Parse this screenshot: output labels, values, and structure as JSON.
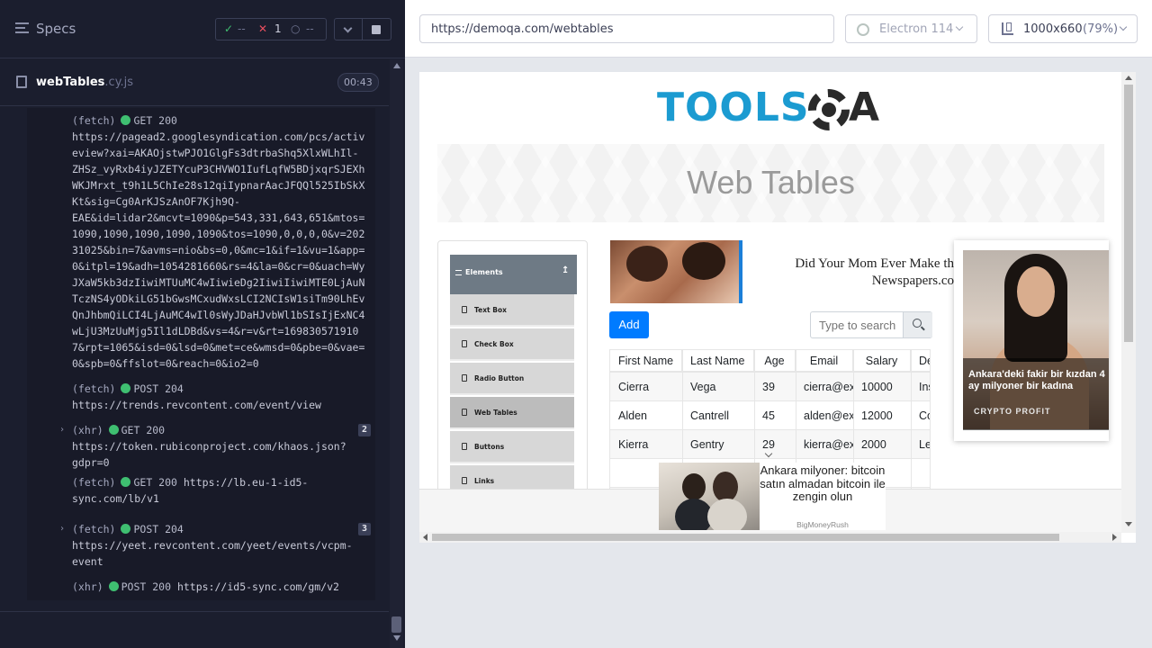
{
  "runner": {
    "specs_label": "Specs",
    "stats": {
      "passed": "--",
      "failed": "1",
      "pending": "--"
    },
    "spec_file": {
      "name": "webTables",
      "ext": ".cy.js",
      "duration": "00:43"
    },
    "log": [
      {
        "type": "(fetch)",
        "method": "GET 200",
        "lines": [
          "https://pagead2.googlesyndication.com/pcs/activ",
          "eview?xai=AKAOjstwPJO1GlgFs3dtrbaShq5XlxWLhIl-",
          "ZHSz_vyRxb4iyJZETYcuP3CHVWO1IufLqfW5BDjxqrSJEXh",
          "WKJMrxt_t9h1L5ChIe28s12qiIypnarAacJFQQl525IbSkX",
          "Kt&sig=Cg0ArKJSzAnOF7Kjh9Q-",
          "EAE&id=lidar2&mcvt=1090&p=543,331,643,651&mtos=",
          "1090,1090,1090,1090,1090&tos=1090,0,0,0,0&v=202",
          "31025&bin=7&avms=nio&bs=0,0&mc=1&if=1&vu=1&app=",
          "0&itpl=19&adh=1054281660&rs=4&la=0&cr=0&uach=Wy",
          "JXaW5kb3dzIiwiMTUuMC4wIiwieDg2IiwiIiwiMTE0LjAuN",
          "TczNS4yODkiLG51bGwsMCxudWxsLCI2NCIsW1siTm90LhEv",
          "QnJhbmQiLCI4LjAuMC4wIl0sWyJDaHJvbWl1bSIsIjExNC4",
          "wLjU3MzUuMjg5Il1dLDBd&vs=4&r=v&rt=169830571910",
          "7&rpt=1065&isd=0&lsd=0&met=ce&wmsd=0&pbe=0&vae=",
          "0&spb=0&ffslot=0&reach=0&io2=0"
        ]
      },
      {
        "type": "(fetch)",
        "method": "POST 204",
        "lines": [
          "https://trends.revcontent.com/event/view"
        ]
      },
      {
        "type": "(xhr)",
        "method": "GET 200",
        "badge": "2",
        "lines": [
          "https://token.rubiconproject.com/khaos.json?",
          "gdpr=0"
        ]
      },
      {
        "type": "(fetch)",
        "method": "GET 200",
        "inline": "https://lb.eu-1-id5-",
        "lines": [
          "sync.com/lb/v1"
        ]
      },
      {
        "type": "(fetch)",
        "method": "POST 204",
        "badge": "3",
        "lines": [
          "https://yeet.revcontent.com/yeet/events/vcpm-",
          "event"
        ]
      },
      {
        "type": "(xhr)",
        "method": "POST 200",
        "inline": "https://id5-sync.com/gm/v2",
        "lines": []
      }
    ]
  },
  "browser": {
    "url": "https://demoqa.com/webtables",
    "name": "Electron 114",
    "viewport": "1000x660",
    "zoom": "(79%)"
  },
  "site": {
    "logo_text": "TOOLS",
    "logo_a": "A",
    "page_title": "Web Tables",
    "group": "Elements",
    "menu": [
      "Text Box",
      "Check Box",
      "Radio Button",
      "Web Tables",
      "Buttons",
      "Links"
    ],
    "active_menu": "Web Tables",
    "ad_top_text": "Did Your Mom Ever Make th Newspapers.co",
    "add_label": "Add",
    "search_placeholder": "Type to search",
    "table": {
      "headers": [
        "First Name",
        "Last Name",
        "Age",
        "Email",
        "Salary",
        "Dep"
      ],
      "rows": [
        [
          "Cierra",
          "Vega",
          "39",
          "cierra@ex...",
          "10000",
          "Insu"
        ],
        [
          "Alden",
          "Cantrell",
          "45",
          "alden@ex...",
          "12000",
          "Com"
        ],
        [
          "Kierra",
          "Gentry",
          "29",
          "kierra@ex...",
          "2000",
          "Leg"
        ]
      ]
    },
    "side_ad": {
      "text": "Ankara'deki fakir bir kızdan 4 ay milyoner bir kadına",
      "brand": "CRYPTO PROFIT"
    },
    "bottom_ad": {
      "title": "Ankara milyoner: bitcoin satın almadan bitcoin ile zengin olun",
      "brand": "BigMoneyRush"
    }
  },
  "colors": {
    "runner_bg": "#1b1e2e",
    "pass": "#3fbf71",
    "fail": "#e94f5f",
    "link_blue": "#007bff",
    "logo_blue": "#1b9bd1"
  }
}
